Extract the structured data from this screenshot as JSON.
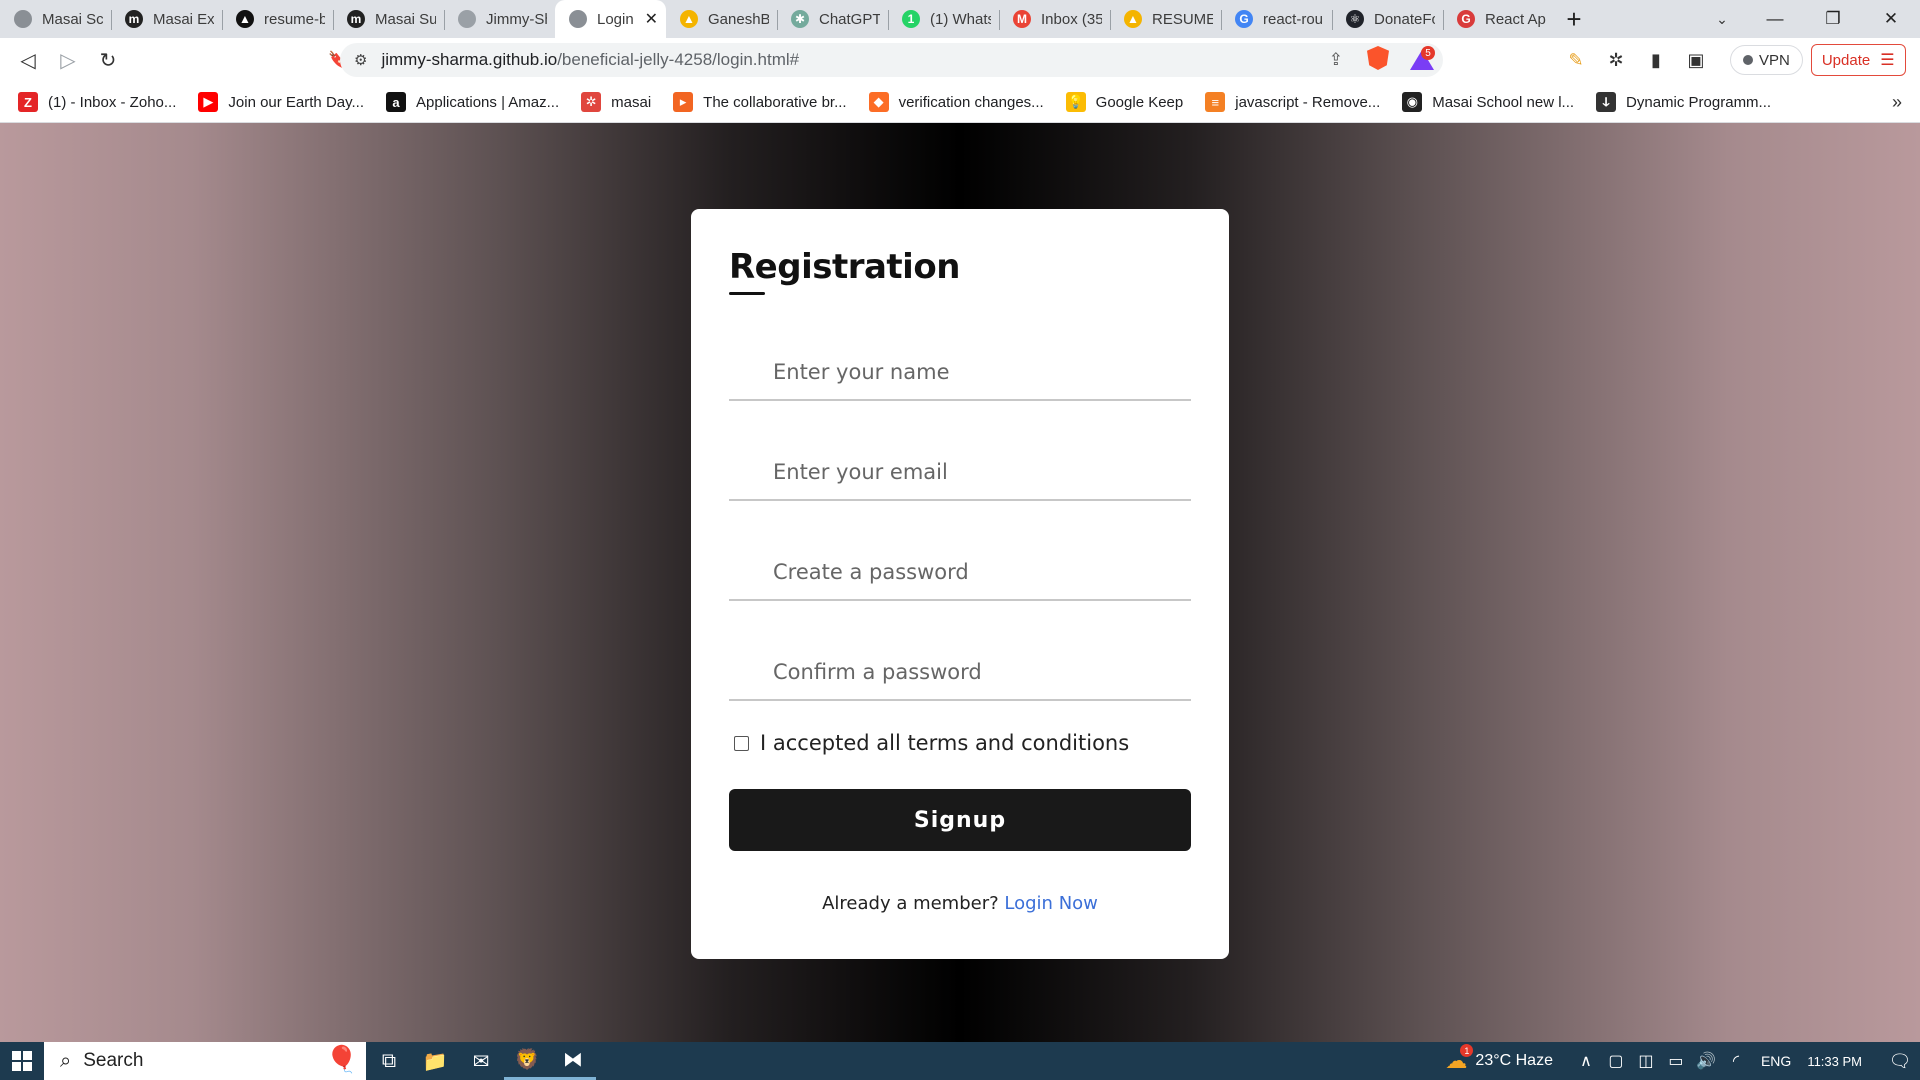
{
  "browser": {
    "tabs": [
      {
        "title": "Masai Sch",
        "icon": "globe-icon",
        "color": "#8a8f95",
        "glyph": ""
      },
      {
        "title": "Masai Exp",
        "icon": "masai-m-icon",
        "color": "#222222",
        "glyph": "m"
      },
      {
        "title": "resume-b",
        "icon": "vercel-icon",
        "color": "#111111",
        "glyph": "▲"
      },
      {
        "title": "Masai Sup",
        "icon": "masai-m-icon",
        "color": "#222222",
        "glyph": "m"
      },
      {
        "title": "Jimmy-Sh",
        "icon": "github-icon",
        "color": "#9aa0a6",
        "glyph": ""
      },
      {
        "title": "Login",
        "icon": "globe-icon",
        "color": "#8a8f95",
        "glyph": "",
        "active": true
      },
      {
        "title": "GaneshBe",
        "icon": "google-drive-icon",
        "color": "#f4b400",
        "glyph": "▲"
      },
      {
        "title": "ChatGPT",
        "icon": "chatgpt-icon",
        "color": "#74aa9c",
        "glyph": "✱"
      },
      {
        "title": "(1) Whats",
        "icon": "whatsapp-icon",
        "color": "#25d366",
        "glyph": "1"
      },
      {
        "title": "Inbox (35",
        "icon": "gmail-icon",
        "color": "#ea4335",
        "glyph": "M"
      },
      {
        "title": "RESUME -",
        "icon": "google-drive-icon",
        "color": "#f4b400",
        "glyph": "▲"
      },
      {
        "title": "react-rou",
        "icon": "google-icon",
        "color": "#4285f4",
        "glyph": "G"
      },
      {
        "title": "DonateFo",
        "icon": "react-icon",
        "color": "#20232a",
        "glyph": "⚛"
      },
      {
        "title": "React App",
        "icon": "app-icon",
        "color": "#d93b3b",
        "glyph": "G"
      }
    ],
    "close_glyph": "✕",
    "new_tab_glyph": "+",
    "tab_menu_glyph": "⌄",
    "window_controls": {
      "minimize": "—",
      "restore": "❐",
      "close": "✕"
    },
    "nav": {
      "back": "◁",
      "forward": "▷",
      "reload": "↻",
      "bookmark": "🔖"
    },
    "omnibox": {
      "site_settings_glyph": "⚙",
      "host": "jimmy-sharma.github.io",
      "path": "/beneficial-jelly-4258/login.html#",
      "share_glyph": "⇪"
    },
    "rewards_badge": "5",
    "toolbar_right": {
      "pen": "✎",
      "extensions": "✲",
      "sidebar": "▮",
      "wallet": "▣"
    },
    "vpn_label": "VPN",
    "update_label": "Update",
    "menu_glyph": "☰"
  },
  "bookmarks": [
    {
      "label": "(1) - Inbox - Zoho...",
      "icon": "zoho-icon",
      "color": "#e42527",
      "glyph": "Z"
    },
    {
      "label": "Join our Earth Day...",
      "icon": "youtube-icon",
      "color": "#ff0000",
      "glyph": "▶"
    },
    {
      "label": "Applications | Amaz...",
      "icon": "amazon-icon",
      "color": "#111111",
      "glyph": "a"
    },
    {
      "label": "masai",
      "icon": "masai-icon",
      "color": "#e0463e",
      "glyph": "✲"
    },
    {
      "label": "The collaborative br...",
      "icon": "figma-like-icon",
      "color": "#f26522",
      "glyph": "▸"
    },
    {
      "label": "verification changes...",
      "icon": "gitlab-icon",
      "color": "#fc6d26",
      "glyph": "◆"
    },
    {
      "label": "Google Keep",
      "icon": "google-keep-icon",
      "color": "#fbbc04",
      "glyph": "💡"
    },
    {
      "label": "javascript - Remove...",
      "icon": "stackoverflow-icon",
      "color": "#f48024",
      "glyph": "≡"
    },
    {
      "label": "Masai School new l...",
      "icon": "globe-dark-icon",
      "color": "#222222",
      "glyph": "◉"
    },
    {
      "label": "Dynamic Programm...",
      "icon": "leetcode-icon",
      "color": "#333333",
      "glyph": "ↆ"
    }
  ],
  "bookmarks_more": "»",
  "form": {
    "title": "Registration",
    "name_placeholder": "Enter your name",
    "email_placeholder": "Enter your email",
    "password_placeholder": "Create a password",
    "confirm_placeholder": "Confirm a password",
    "terms_label": "I accepted all terms and conditions",
    "signup_label": "Signup",
    "member_text": "Already a member?",
    "login_link": "Login Now"
  },
  "taskbar": {
    "search_label": "Search",
    "search_glyph": "⌕",
    "balloon_glyph": "🎈",
    "apps": [
      {
        "name": "task-view-icon",
        "glyph": "⧉"
      },
      {
        "name": "file-explorer-icon",
        "glyph": "📁"
      },
      {
        "name": "mail-icon",
        "glyph": "✉"
      },
      {
        "name": "brave-browser-icon",
        "glyph": "🦁"
      },
      {
        "name": "vscode-icon",
        "glyph": "⧓"
      }
    ],
    "weather_badge": "1",
    "weather": "23°C  Haze",
    "tray_icons": [
      {
        "name": "tray-chevron-icon",
        "glyph": "∧"
      },
      {
        "name": "meet-now-icon",
        "glyph": "▢"
      },
      {
        "name": "screen-icon",
        "glyph": "◫"
      },
      {
        "name": "battery-icon",
        "glyph": "▭"
      },
      {
        "name": "volume-icon",
        "glyph": "🔊"
      },
      {
        "name": "wifi-icon",
        "glyph": "◜"
      }
    ],
    "language": "ENG",
    "clock": "11:33 PM",
    "notification_glyph": "🗨"
  },
  "colors": {
    "link": "#3b6fd8",
    "button_bg": "#191919",
    "update_accent": "#d93025",
    "taskbar": "#1d3a4f"
  }
}
